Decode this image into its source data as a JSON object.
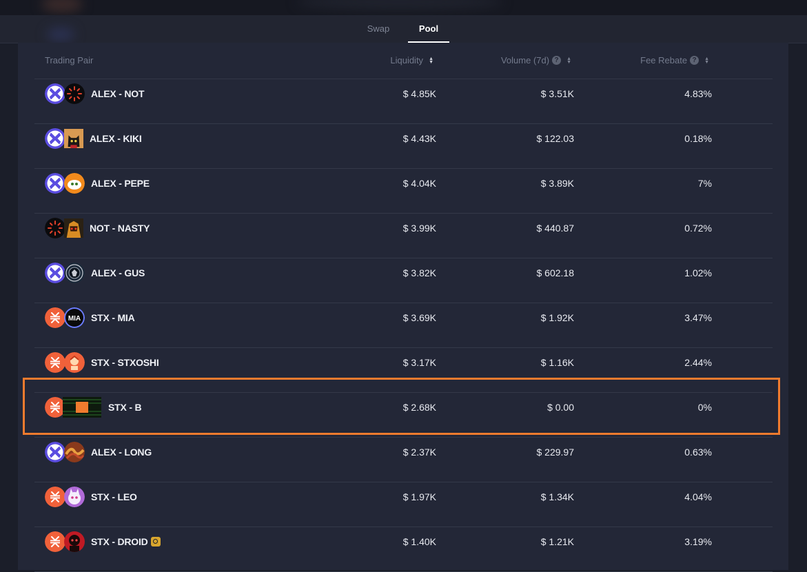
{
  "tabs": [
    {
      "label": "Swap",
      "active": false
    },
    {
      "label": "Pool",
      "active": true
    }
  ],
  "table": {
    "headers": {
      "pair": "Trading Pair",
      "liquidity": "Liquidity",
      "volume": "Volume (7d)",
      "fee": "Fee Rebate"
    },
    "rows": [
      {
        "pair": "ALEX - NOT",
        "liquidity": "$ 4.85K",
        "volume": "$ 3.51K",
        "fee": "4.83%"
      },
      {
        "pair": "ALEX - KIKI",
        "liquidity": "$ 4.43K",
        "volume": "$ 122.03",
        "fee": "0.18%"
      },
      {
        "pair": "ALEX - PEPE",
        "liquidity": "$ 4.04K",
        "volume": "$ 3.89K",
        "fee": "7%"
      },
      {
        "pair": "NOT - NASTY",
        "liquidity": "$ 3.99K",
        "volume": "$ 440.87",
        "fee": "0.72%"
      },
      {
        "pair": "ALEX - GUS",
        "liquidity": "$ 3.82K",
        "volume": "$ 602.18",
        "fee": "1.02%"
      },
      {
        "pair": "STX - MIA",
        "liquidity": "$ 3.69K",
        "volume": "$ 1.92K",
        "fee": "3.47%"
      },
      {
        "pair": "STX - STXOSHI",
        "liquidity": "$ 3.17K",
        "volume": "$ 1.16K",
        "fee": "2.44%"
      },
      {
        "pair": "STX - B",
        "liquidity": "$ 2.68K",
        "volume": "$ 0.00",
        "fee": "0%"
      },
      {
        "pair": "ALEX - LONG",
        "liquidity": "$ 2.37K",
        "volume": "$ 229.97",
        "fee": "0.63%"
      },
      {
        "pair": "STX - LEO",
        "liquidity": "$ 1.97K",
        "volume": "$ 1.34K",
        "fee": "4.04%"
      },
      {
        "pair": "STX - DROID",
        "liquidity": "$ 1.40K",
        "volume": "$ 1.21K",
        "fee": "3.19%"
      }
    ]
  },
  "token_icons": {
    "mia_label": "MIA"
  },
  "colors": {
    "accent_highlight": "#f07b2e",
    "alex_token": "#5b4de0",
    "stx_token": "#f0613a",
    "page_bg": "#1b1e29",
    "panel_bg": "#232737"
  }
}
